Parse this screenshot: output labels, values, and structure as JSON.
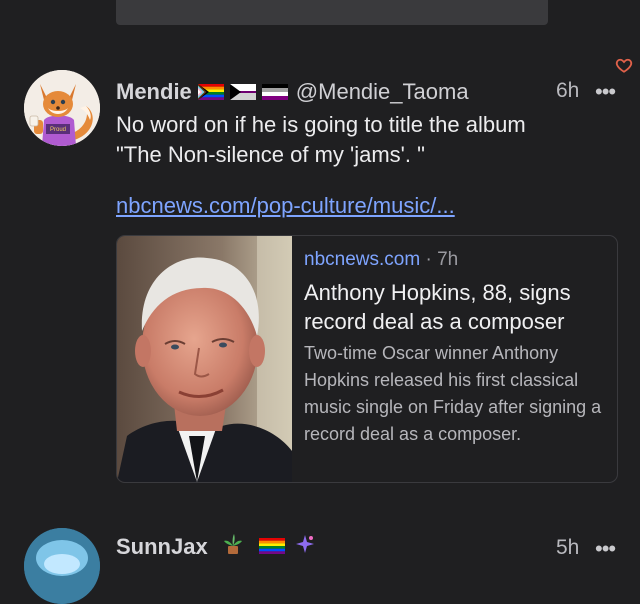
{
  "post": {
    "display_name": "Mendie",
    "handle": "@Mendie_Taoma",
    "time": "6h",
    "text": "No word on if he is going to title the album \"The Non-silence of my 'jams'. \"",
    "link_text": "nbcnews.com/pop-culture/music/...",
    "avatar_badge": "Proud",
    "card": {
      "source": "nbcnews.com",
      "age": "7h",
      "separator": "·",
      "title": "Anthony Hopkins, 88, signs record deal as a composer",
      "description": "Two-time Oscar winner Anthony Hopkins released his first classical music single on Friday after signing a record deal as a composer."
    }
  },
  "next_post": {
    "display_name": "SunnJax",
    "time": "5h"
  },
  "icons": {
    "like": "heart-icon",
    "more": "more-icon",
    "flags": [
      "progress-pride-flag",
      "demisexual-flag",
      "asexual-flag"
    ]
  },
  "colors": {
    "background": "#1f1f21",
    "link": "#7ea4ff",
    "heart": "#e0614a"
  },
  "more_glyph": "•••"
}
